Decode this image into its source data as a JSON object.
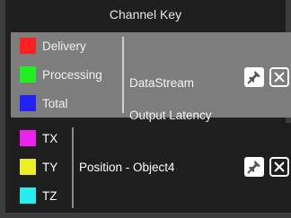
{
  "header": {
    "title": "Channel Key"
  },
  "groups": [
    {
      "items": [
        {
          "label": "Delivery",
          "color": "#ff2020"
        },
        {
          "label": "Processing",
          "color": "#22ee22"
        },
        {
          "label": "Total",
          "color": "#2222ff"
        }
      ],
      "name_line1": "DataStream",
      "name_line2": "Output Latency"
    },
    {
      "items": [
        {
          "label": "TX",
          "color": "#ee22ee"
        },
        {
          "label": "TY",
          "color": "#eeee22"
        },
        {
          "label": "TZ",
          "color": "#22eeee"
        }
      ],
      "name": "Position - Object4"
    }
  ],
  "icons": {
    "pin": "pin-icon",
    "close": "close-icon"
  }
}
